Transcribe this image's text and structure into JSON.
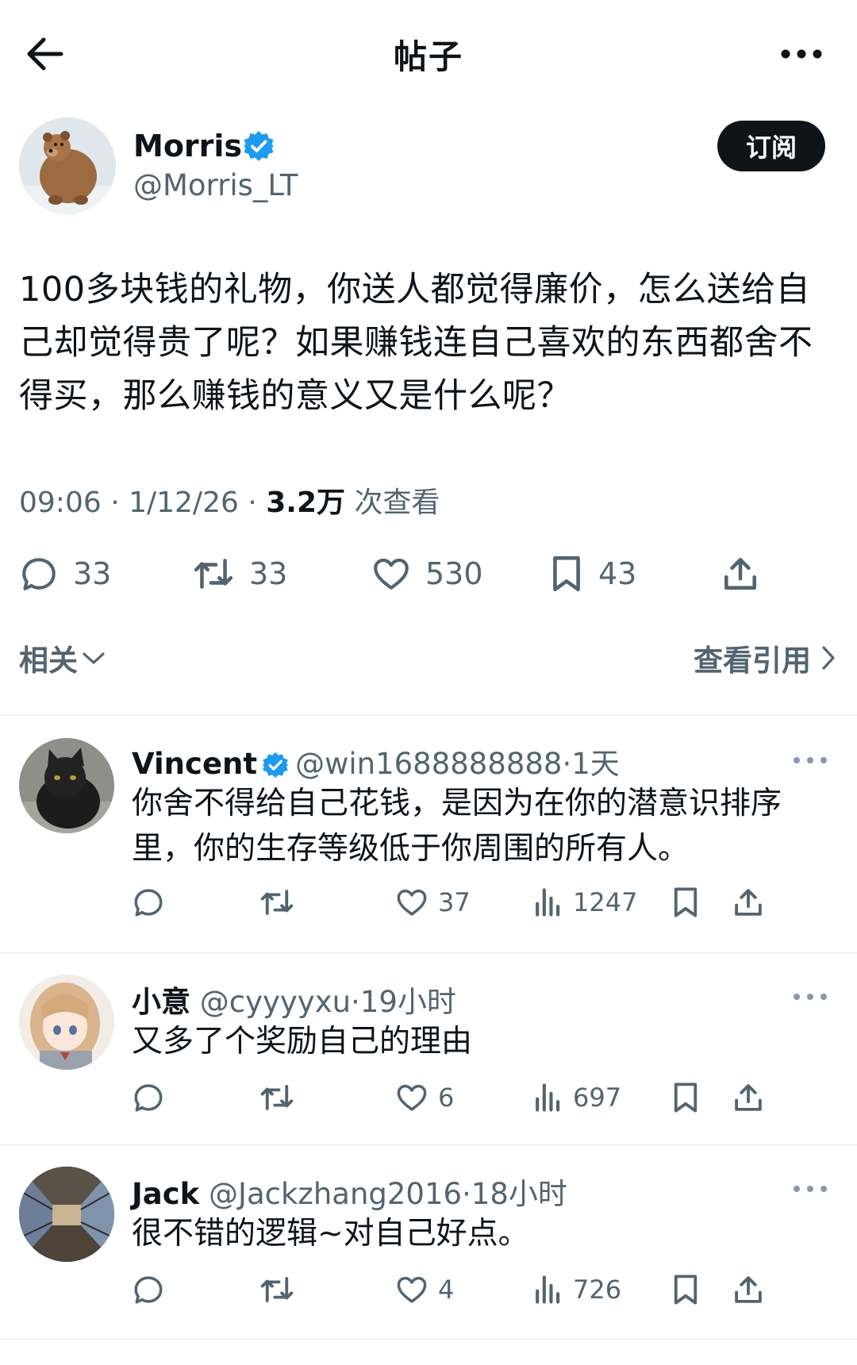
{
  "header": {
    "title": "帖子",
    "back_icon": "arrow-left-icon",
    "more_icon": "more-horizontal-icon"
  },
  "post": {
    "author_name": "Morris",
    "author_handle": "@Morris_LT",
    "verified": true,
    "subscribe_label": "订阅",
    "text": "100多块钱的礼物，你送人都觉得廉价，怎么送给自己却觉得贵了呢？如果赚钱连自己喜欢的东西都舍不得买，那么赚钱的意义又是什么呢？",
    "time": "09:06",
    "date": "1/12/26",
    "views_count": "3.2万",
    "views_label": "次查看",
    "stats": {
      "replies": "33",
      "reposts": "33",
      "likes": "530",
      "bookmarks": "43"
    },
    "related_label": "相关",
    "quotes_label": "查看引用"
  },
  "replies": [
    {
      "name": "Vincent",
      "verified": true,
      "handle": "@win1688888888",
      "time": "1天",
      "text": "你舍不得给自己花钱，是因为在你的潜意识排序里，你的生存等级低于你周围的所有人。",
      "likes": "37",
      "views": "1247"
    },
    {
      "name": "小意",
      "verified": false,
      "handle": "@cyyyyxu",
      "time": "19小时",
      "text": "又多了个奖励自己的理由",
      "likes": "6",
      "views": "697"
    },
    {
      "name": "Jack",
      "verified": false,
      "handle": "@Jackzhang2016",
      "time": "18小时",
      "text": "很不错的逻辑~对自己好点。",
      "likes": "4",
      "views": "726"
    }
  ],
  "colors": {
    "text": "#0f1419",
    "secondary": "#536471",
    "verified_blue": "#1d9bf0",
    "divider": "#eff3f4"
  }
}
